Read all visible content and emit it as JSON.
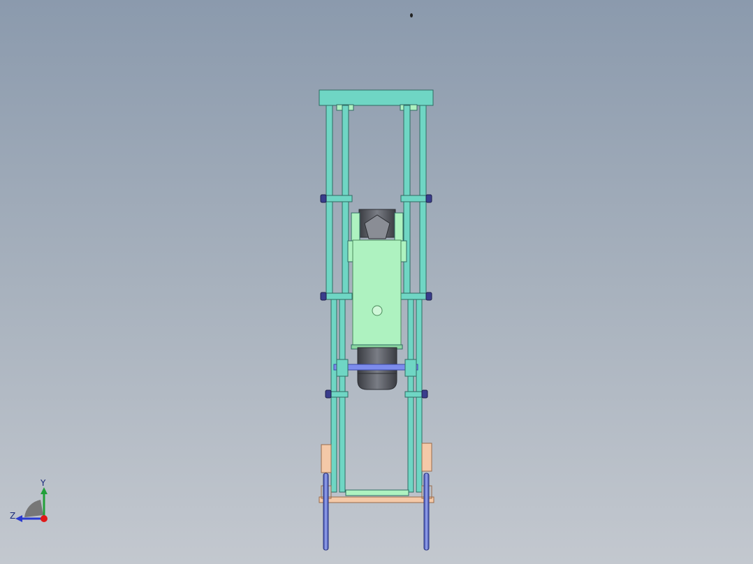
{
  "viewport": {
    "background_top": "#8b9aad",
    "background_bottom": "#c3c8cf"
  },
  "colors": {
    "frame": "#6fd6c4",
    "frame_dark": "#2f7a70",
    "body": "#aef2c0",
    "body_dark": "#4a8a5a",
    "motor": "#5c5f66",
    "motor_dark": "#2c2e33",
    "bolt": "#3a3d8c",
    "foot": "#f4c9a8",
    "leg": "#6f7fd6"
  },
  "triad": {
    "x_label": "",
    "y_label": "Y",
    "z_label": "Z"
  }
}
